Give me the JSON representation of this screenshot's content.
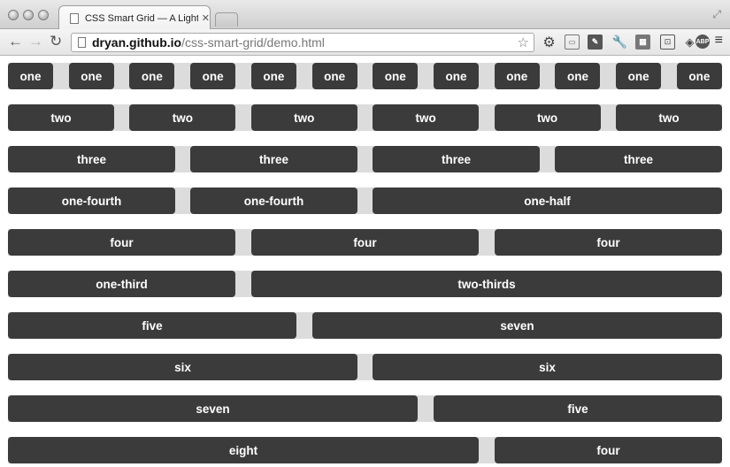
{
  "browser": {
    "tab_title": "CSS Smart Grid — A Lightw",
    "tab_close": "✕",
    "url_host": "dryan.github.io",
    "url_path": "/css-smart-grid/demo.html"
  },
  "grid": {
    "rows": [
      [
        "one",
        "one",
        "one",
        "one",
        "one",
        "one",
        "one",
        "one",
        "one",
        "one",
        "one",
        "one"
      ],
      [
        "two",
        "two",
        "two",
        "two",
        "two",
        "two"
      ],
      [
        "three",
        "three",
        "three",
        "three"
      ],
      [
        "one-fourth",
        "one-fourth",
        "one-half"
      ],
      [
        "four",
        "four",
        "four"
      ],
      [
        "one-third",
        "two-thirds"
      ],
      [
        "five",
        "seven"
      ],
      [
        "six",
        "six"
      ],
      [
        "seven",
        "five"
      ],
      [
        "eight",
        "four"
      ]
    ]
  }
}
